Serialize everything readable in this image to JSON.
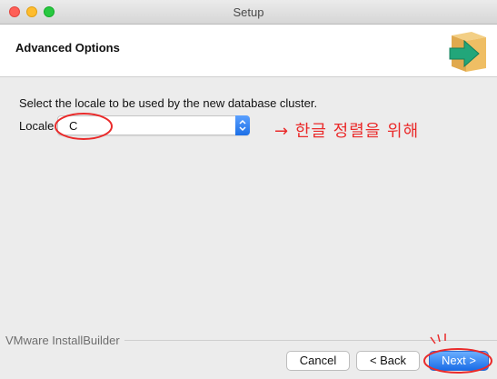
{
  "window": {
    "title": "Setup"
  },
  "header": {
    "title": "Advanced Options"
  },
  "content": {
    "prompt": "Select the locale to be used by the new database cluster.",
    "locale_label": "Locale",
    "locale_value": "C"
  },
  "annotation": {
    "text": "→ 한글 정렬을 위해",
    "color": "#ea2a2a"
  },
  "footer": {
    "brand": "VMware InstallBuilder",
    "buttons": {
      "cancel": "Cancel",
      "back": "< Back",
      "next": "Next >"
    }
  },
  "colors": {
    "accent": "#1b6de6",
    "annotation": "#ea2a2a"
  }
}
